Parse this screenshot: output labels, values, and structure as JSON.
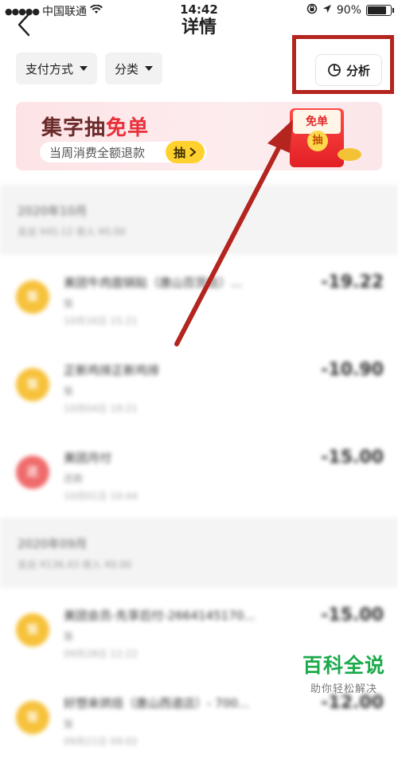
{
  "status_bar": {
    "signal": "●●●●●",
    "carrier": "中国联通",
    "time": "14:42",
    "battery": "90%",
    "battery_level": 0.9
  },
  "nav": {
    "title": "详情"
  },
  "filters": {
    "payment_label": "支付方式",
    "category_label": "分类"
  },
  "analysis_button": {
    "label": "分析"
  },
  "banner": {
    "title_main": "集字抽",
    "title_accent": "免单",
    "subtitle": "当周消费全额退款",
    "button_label": "抽",
    "packet_label": "免单",
    "packet_coin": "抽"
  },
  "sections": [
    {
      "month": "2020年10月",
      "summary": "支出 ¥45.12   收入 ¥0.00",
      "rows": [
        {
          "name": "美团牛肉面锅贴（唐山百货店）...",
          "sub": "饭",
          "time": "10月16日 15:21",
          "amount": "-19.22",
          "icon": "饭",
          "color": "#f7c23b"
        },
        {
          "name": "正新鸡排正新鸡排",
          "sub": "饭",
          "time": "10月04日 19:21",
          "amount": "-10.90",
          "icon": "饭",
          "color": "#f7c23b"
        },
        {
          "name": "美团月付",
          "sub": "还款",
          "time": "10月01日 10:44",
          "amount": "-15.00",
          "icon": "还",
          "color": "#f06b6b"
        }
      ]
    },
    {
      "month": "2020年09月",
      "summary": "支出 ¥136.43   收入 ¥0.00",
      "rows": [
        {
          "name": "美团会员-先享后付-2664145170...",
          "sub": "饭",
          "time": "09月28日 12:22",
          "amount": "-15.00",
          "icon": "饭",
          "color": "#f7c23b"
        },
        {
          "name": "好想来烘焙（唐山西道店）- 700...",
          "sub": "饭",
          "time": "09月21日 09:02",
          "amount": "-12.00",
          "icon": "饭",
          "color": "#f7c23b"
        }
      ]
    }
  ],
  "watermark": {
    "main": "百科全说",
    "sub": "助你轻松解决"
  },
  "colors": {
    "highlight_red": "#b4251f",
    "banner_yellow": "#ffd12e",
    "watermark_green": "#1ba94b"
  }
}
